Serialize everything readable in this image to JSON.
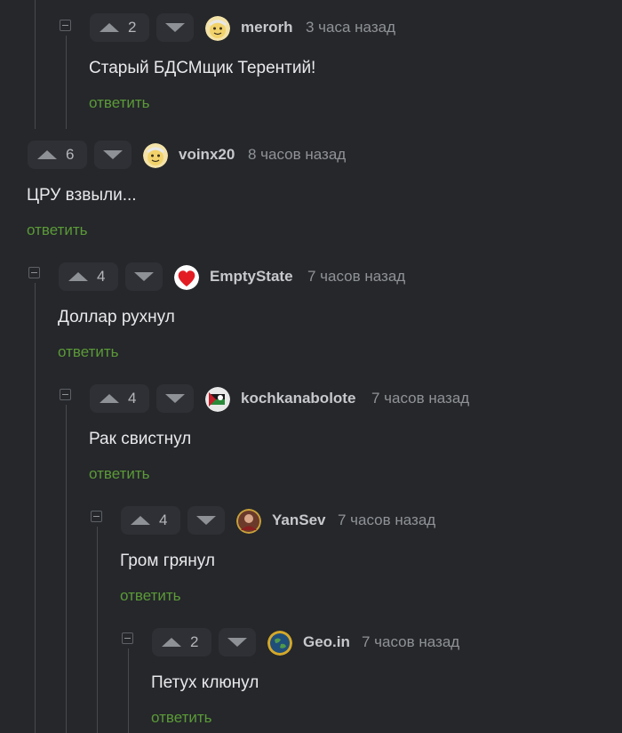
{
  "comments": [
    {
      "votes": "2",
      "username": "merorh",
      "time": "3 часа назад",
      "text": "Старый БДСМщик Терентий!",
      "reply": "ответить",
      "avatar": "yellow-face-avatar"
    },
    {
      "votes": "6",
      "username": "voinx20",
      "time": "8 часов назад",
      "text": "ЦРУ взвыли...",
      "reply": "ответить",
      "avatar": "yellow-face-avatar"
    },
    {
      "votes": "4",
      "username": "EmptyState",
      "time": "7 часов назад",
      "text": "Доллар рухнул",
      "reply": "ответить",
      "avatar": "heart-avatar"
    },
    {
      "votes": "4",
      "username": "kochkanabolote",
      "time": "7 часов назад",
      "text": "Рак свистнул",
      "reply": "ответить",
      "avatar": "flag-avatar"
    },
    {
      "votes": "4",
      "username": "YanSev",
      "time": "7 часов назад",
      "text": "Гром грянул",
      "reply": "ответить",
      "avatar": "portrait-avatar"
    },
    {
      "votes": "2",
      "username": "Geo.in",
      "time": "7 часов назад",
      "text": "Петух клюнул",
      "reply": "ответить",
      "avatar": "globe-avatar"
    }
  ],
  "colors": {
    "background": "#25272b",
    "vote_bg": "#2e3035",
    "reply_link": "#5b9a37",
    "username": "#c6c8cc",
    "timestamp": "#8f9296",
    "thread_line": "#47494e"
  }
}
